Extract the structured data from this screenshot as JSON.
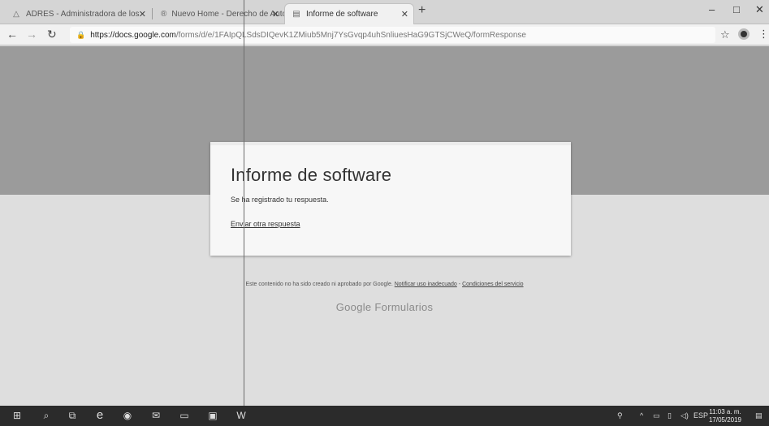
{
  "tabs": [
    {
      "label": "ADRES - Administradora de los",
      "icon": "adres-triangle-icon"
    },
    {
      "label": "Nuevo Home - Derecho de Autor",
      "icon": "registered-icon"
    },
    {
      "label": "Informe de software",
      "icon": "forms-icon",
      "active": true
    }
  ],
  "address_bar": {
    "host": "https://docs.google.com",
    "path": "/forms/d/e/1FAIpQLSdsDIQevK1ZMiub5Mnj7YsGvqp4uhSnliuesHaG9GTSjCWeQ/formResponse"
  },
  "form": {
    "title": "Informe de software",
    "message": "Se ha registrado tu respuesta.",
    "link": "Enviar otra respuesta"
  },
  "footer": {
    "notice": "Este contenido no ha sido creado ni aprobado por Google.",
    "report_link": "Notificar uso inadecuado",
    "separator": "-",
    "terms_link": "Condiciones del servicio",
    "brand": "Google Formularios"
  },
  "taskbar": {
    "language": "ESP",
    "time": "11:03 a. m.",
    "date": "17/05/2019"
  },
  "colors": {
    "banner": "#9b9b9b",
    "card": "#f7f7f7",
    "taskbar": "#2b2b2b"
  }
}
